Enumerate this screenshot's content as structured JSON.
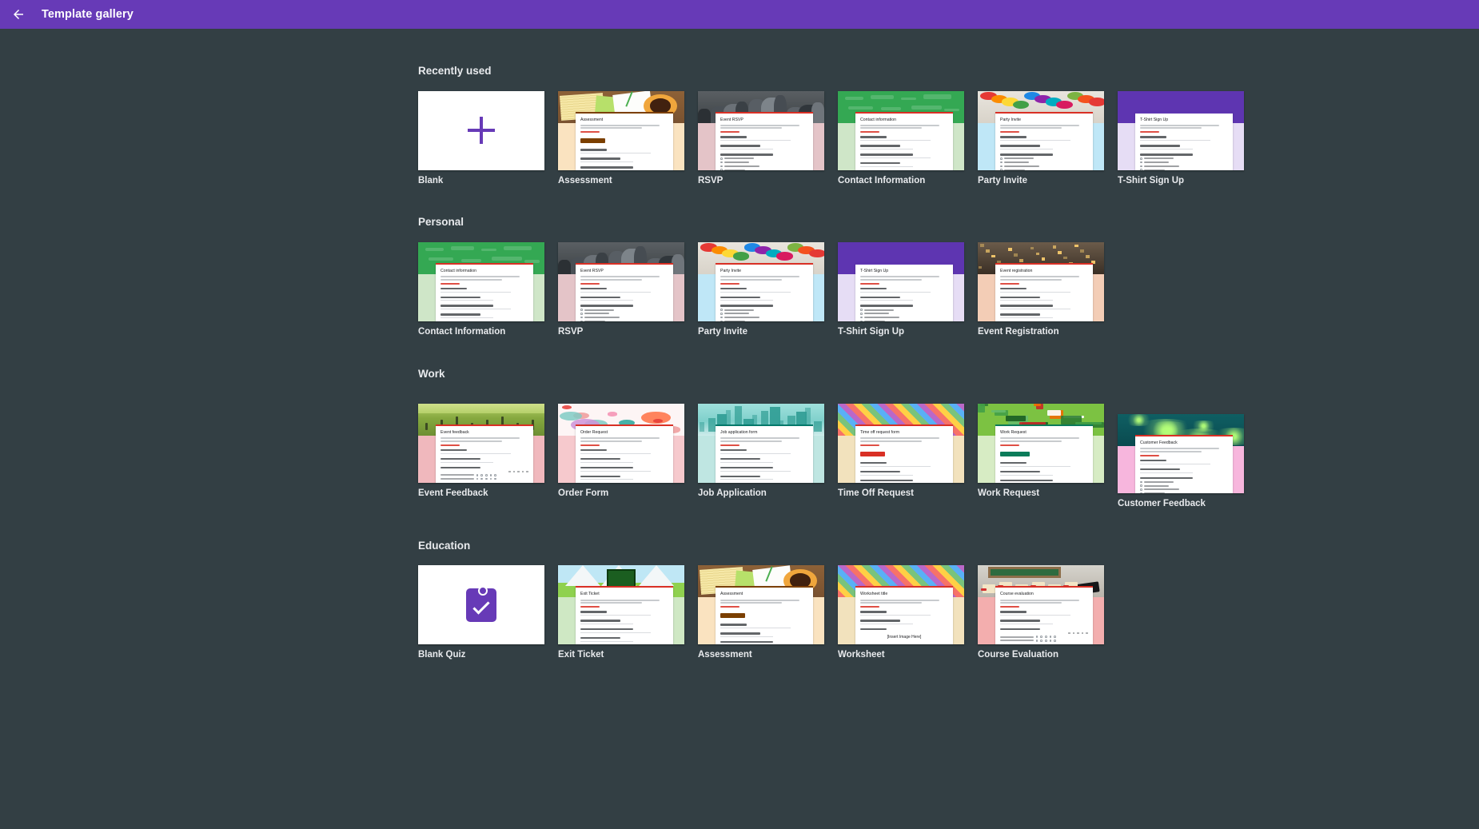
{
  "header": {
    "back_icon": "arrow-left-icon",
    "title": "Template gallery"
  },
  "theme": {
    "accent": "#673ab7",
    "page_background": "#333f44",
    "label_color": "#e8eaed",
    "card_background": "#ffffff",
    "required_marker": "#d93025"
  },
  "sections": [
    {
      "id": "recently-used",
      "title": "Recently used",
      "templates": [
        {
          "label": "Blank",
          "kind": "blank",
          "icon": "plus-icon"
        },
        {
          "label": "Assessment",
          "kind": "form",
          "art": "art-desk",
          "body_color": "#fae3c0",
          "card_title": "Assessment",
          "accent": "#7b3f00",
          "button": true
        },
        {
          "label": "RSVP",
          "kind": "form",
          "art": "art-crowd",
          "body_color": "#e4c4c8",
          "card_title": "Event RSVP",
          "accent": "#d93025",
          "options": true
        },
        {
          "label": "Contact Information",
          "kind": "form",
          "art": "art-greendoodle",
          "body_color": "#cfe6c8",
          "card_title": "Contact information",
          "accent": "#d93025"
        },
        {
          "label": "Party Invite",
          "kind": "form",
          "art": "art-balloons",
          "body_color": "#bfe7f7",
          "card_title": "Party Invite",
          "accent": "#d93025",
          "options": true
        },
        {
          "label": "T-Shirt Sign Up",
          "kind": "form",
          "art": "art-purple",
          "body_color": "#e6ddf5",
          "card_title": "T-Shirt Sign Up",
          "accent": "#5e35b1",
          "options": true
        }
      ]
    },
    {
      "id": "personal",
      "title": "Personal",
      "templates": [
        {
          "label": "Contact Information",
          "kind": "form",
          "art": "art-greendoodle",
          "body_color": "#cfe6c8",
          "card_title": "Contact information",
          "accent": "#d93025"
        },
        {
          "label": "RSVP",
          "kind": "form",
          "art": "art-crowd",
          "body_color": "#e4c4c8",
          "card_title": "Event RSVP",
          "accent": "#d93025",
          "options": true
        },
        {
          "label": "Party Invite",
          "kind": "form",
          "art": "art-balloons",
          "body_color": "#bfe7f7",
          "card_title": "Party Invite",
          "accent": "#d93025",
          "options": true
        },
        {
          "label": "T-Shirt Sign Up",
          "kind": "form",
          "art": "art-purple",
          "body_color": "#e6ddf5",
          "card_title": "T-Shirt Sign Up",
          "accent": "#5e35b1",
          "options": true
        },
        {
          "label": "Event Registration",
          "kind": "form",
          "art": "art-building",
          "body_color": "#f3cdb6",
          "card_title": "Event registration",
          "accent": "#d93025"
        }
      ]
    },
    {
      "id": "work",
      "title": "Work",
      "templates": [
        {
          "label": "Event Feedback",
          "kind": "form",
          "art": "art-field",
          "body_color": "#f0b8bd",
          "card_title": "Event feedback",
          "accent": "#d93025",
          "grid": true
        },
        {
          "label": "Order Form",
          "kind": "form",
          "art": "art-floral",
          "body_color": "#f6c9cd",
          "card_title": "Order Request",
          "accent": "#d93025"
        },
        {
          "label": "Job Application",
          "kind": "form",
          "art": "art-city",
          "body_color": "#bfe6e2",
          "card_title": "Job application form",
          "accent": "#00796b"
        },
        {
          "label": "Time Off Request",
          "kind": "form",
          "art": "art-diamond",
          "body_color": "#f2e2bd",
          "card_title": "Time off request form",
          "accent": "#d93025",
          "options": true,
          "button": true
        },
        {
          "label": "Work Request",
          "kind": "form",
          "art": "art-map",
          "body_color": "#d7ecc4",
          "card_title": "Work Request",
          "accent": "#0b7c5a",
          "sections": true
        },
        {
          "label": "Customer Feedback",
          "kind": "form",
          "art": "art-fireworks",
          "body_color": "#f7b6dd",
          "card_title": "Customer Feedback",
          "accent": "#d93025",
          "options": true
        }
      ]
    },
    {
      "id": "education",
      "title": "Education",
      "templates": [
        {
          "label": "Blank Quiz",
          "kind": "quiz",
          "icon": "clipboard-check-icon"
        },
        {
          "label": "Exit Ticket",
          "kind": "form",
          "art": "art-mountain",
          "body_color": "#cfe8c4",
          "card_title": "Exit Ticket",
          "accent": "#d93025"
        },
        {
          "label": "Assessment",
          "kind": "form",
          "art": "art-desk",
          "body_color": "#fae3c0",
          "card_title": "Assessment",
          "accent": "#7b3f00",
          "button": true
        },
        {
          "label": "Worksheet",
          "kind": "form",
          "art": "art-diamond",
          "body_color": "#f2e2bd",
          "card_title": "Worksheet title",
          "accent": "#d93025",
          "insert_text": "[Insert Image Here]"
        },
        {
          "label": "Course Evaluation",
          "kind": "form",
          "art": "art-grad",
          "body_color": "#f3aeae",
          "card_title": "Course evaluation",
          "accent": "#d93025",
          "grid": true
        }
      ]
    }
  ]
}
